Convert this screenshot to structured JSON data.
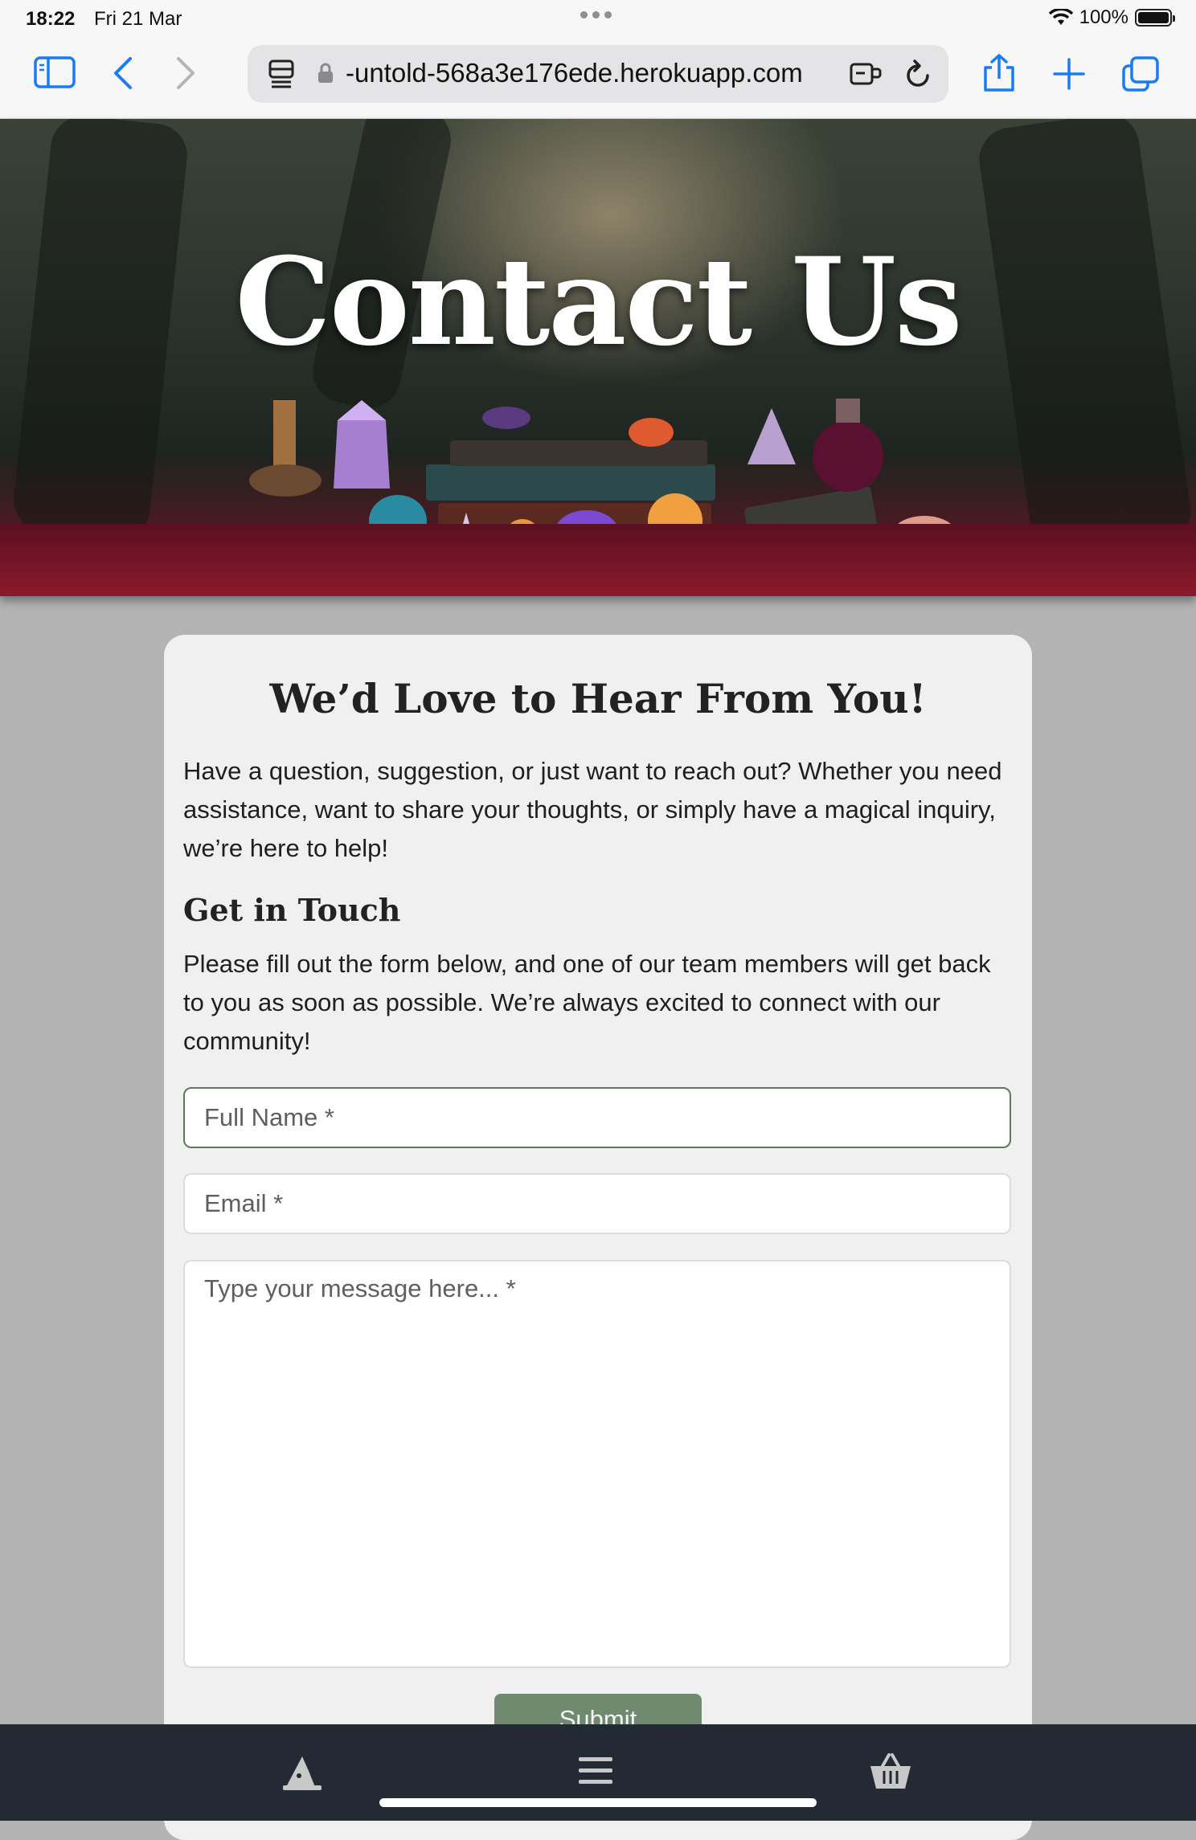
{
  "status_bar": {
    "time": "18:22",
    "date": "Fri 21 Mar",
    "battery": "100%"
  },
  "browser": {
    "url": "-untold-568a3e176ede.herokuapp.com",
    "icons": [
      "sidebar-icon",
      "back-icon",
      "forward-icon",
      "page-menu-icon",
      "lock-icon",
      "extension-icon",
      "reload-icon",
      "share-icon",
      "new-tab-icon",
      "tabs-icon"
    ]
  },
  "hero": {
    "title": "Contact Us"
  },
  "contact": {
    "heading": "We’d Love to Hear From You!",
    "intro": "Have a question, suggestion, or just want to reach out? Whether you need assistance, want to share your thoughts, or simply have a magical inquiry, we’re here to help!",
    "subheading": "Get in Touch",
    "instructions": "Please fill out the form below, and one of our team members will get back to you as soon as possible. We’re always excited to connect with our community!",
    "form": {
      "name_placeholder": "Full Name *",
      "email_placeholder": "Email *",
      "message_placeholder": "Type your message here... *",
      "submit_label": "Submit"
    }
  },
  "bottom_nav": {
    "items": [
      "wizard-hat-icon",
      "menu-icon",
      "basket-icon"
    ]
  },
  "colors": {
    "accent_green": "#6f8a6f",
    "browser_blue": "#1a7cf3",
    "nav_bg": "#232a33"
  }
}
